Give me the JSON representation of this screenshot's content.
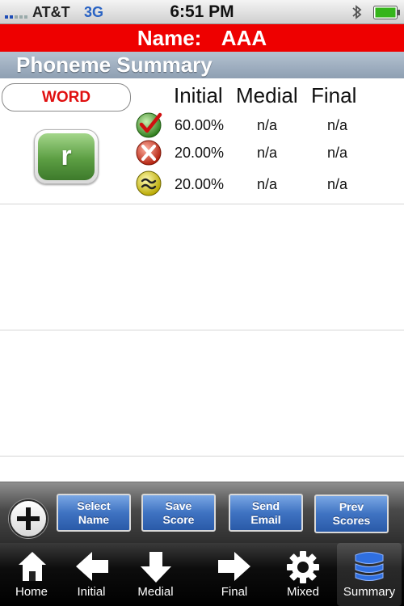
{
  "status_bar": {
    "carrier": "AT&T",
    "network": "3G",
    "time": "6:51 PM",
    "icons": [
      "signal-icon",
      "bluetooth-icon",
      "battery-icon"
    ]
  },
  "name_banner": {
    "label": "Name:",
    "value": "AAA",
    "color": "#ee0000"
  },
  "section_title": "Phoneme Summary",
  "summary": {
    "word_button": "WORD",
    "phoneme": "r",
    "columns": [
      "Initial",
      "Medial",
      "Final"
    ],
    "rows": [
      {
        "icon": "check-icon",
        "initial": "60.00%",
        "medial": "n/a",
        "final": "n/a"
      },
      {
        "icon": "cross-icon",
        "initial": "20.00%",
        "medial": "n/a",
        "final": "n/a"
      },
      {
        "icon": "approx-icon",
        "initial": "20.00%",
        "medial": "n/a",
        "final": "n/a"
      }
    ]
  },
  "toolbar": {
    "add_icon": "plus-icon",
    "buttons": [
      {
        "line1": "Select",
        "line2": "Name"
      },
      {
        "line1": "Save",
        "line2": "Score"
      },
      {
        "line1": "Send",
        "line2": "Email"
      },
      {
        "line1": "Prev",
        "line2": "Scores"
      }
    ],
    "button_color": "#3f73c2"
  },
  "tabs": [
    {
      "label": "Home",
      "icon": "home-icon"
    },
    {
      "label": "Initial",
      "icon": "arrow-left-icon"
    },
    {
      "label": "Medial",
      "icon": "arrow-down-icon"
    },
    {
      "label": "Final",
      "icon": "arrow-right-icon"
    },
    {
      "label": "Mixed",
      "icon": "gear-icon"
    },
    {
      "label": "Summary",
      "icon": "database-icon",
      "active": true
    }
  ],
  "colors": {
    "accent_red": "#e01010",
    "active_tab": "#2f6fe0",
    "phoneme_green": "#5c9e43"
  }
}
